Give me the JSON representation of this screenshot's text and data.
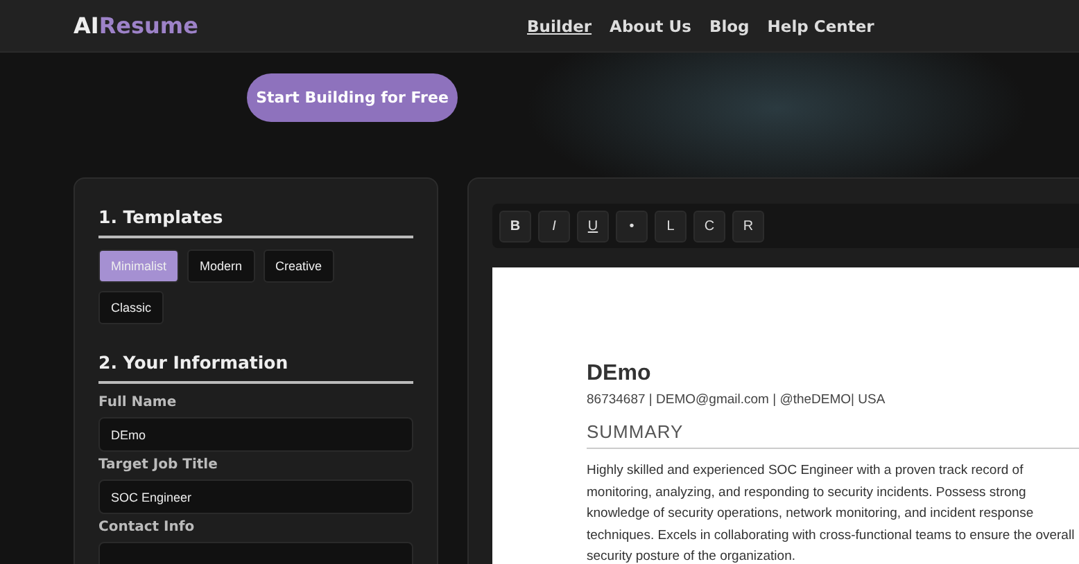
{
  "header": {
    "logo": {
      "part1": "AI",
      "part2": "Resume"
    },
    "nav": [
      {
        "label": "Builder",
        "selected": true
      },
      {
        "label": "About Us",
        "selected": false
      },
      {
        "label": "Blog",
        "selected": false
      },
      {
        "label": "Help Center",
        "selected": false
      }
    ]
  },
  "hero": {
    "cta": "Start Building for Free"
  },
  "form": {
    "templates_title": "1. Templates",
    "templates": [
      {
        "label": "Minimalist",
        "selected": true
      },
      {
        "label": "Modern",
        "selected": false
      },
      {
        "label": "Creative",
        "selected": false
      },
      {
        "label": "Classic",
        "selected": false
      }
    ],
    "info_title": "2. Your Information",
    "fields": [
      {
        "label": "Full Name",
        "value": "DEmo"
      },
      {
        "label": "Target Job Title",
        "value": "SOC Engineer"
      },
      {
        "label": "Contact Info"
      }
    ]
  },
  "editor": {
    "toolbar": [
      {
        "label": "B",
        "kind": "bold"
      },
      {
        "label": "I",
        "kind": "italic"
      },
      {
        "label": "U",
        "kind": "underline"
      },
      {
        "label": "•",
        "kind": "plain"
      },
      {
        "label": "L",
        "kind": "plain"
      },
      {
        "label": "C",
        "kind": "plain"
      },
      {
        "label": "R",
        "kind": "plain"
      }
    ],
    "resume": {
      "name": "DEmo",
      "contact": "86734687 | DEMO@gmail.com | @theDEMO| USA",
      "section": "SUMMARY",
      "summary": "Highly skilled and experienced SOC Engineer with a proven track record of monitoring, analyzing, and responding to security incidents. Possess strong knowledge of security operations, network monitoring, and incident response techniques. Excels in collaborating with cross-functional teams to ensure the overall security posture of the organization."
    }
  }
}
